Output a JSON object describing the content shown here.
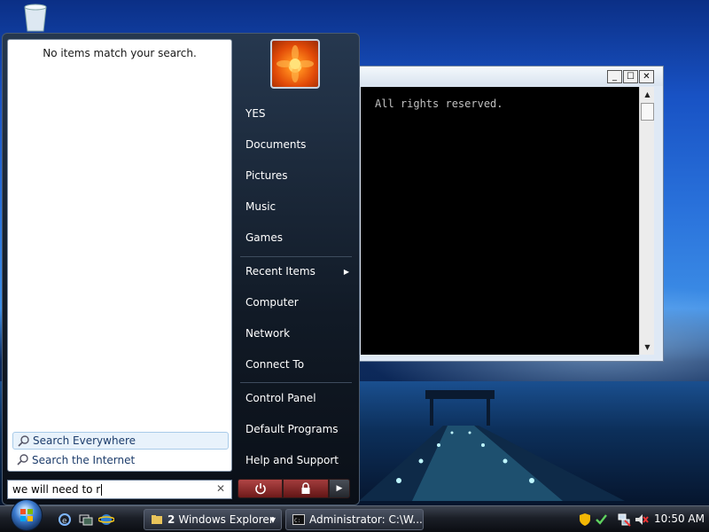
{
  "start_menu": {
    "left_pane": {
      "no_items_text": "No items match your search.",
      "search_options": [
        "Search Everywhere",
        "Search the Internet"
      ]
    },
    "search_box": {
      "value": "we will need to r"
    },
    "right_pane": {
      "group1": [
        "YES",
        "Documents",
        "Pictures",
        "Music",
        "Games"
      ],
      "group2": [
        "Recent Items",
        "Computer",
        "Network",
        "Connect To"
      ],
      "group3": [
        "Control Panel",
        "Default Programs",
        "Help and Support"
      ]
    },
    "power_buttons": [
      "power-icon",
      "lock-icon",
      "arrow-icon"
    ]
  },
  "console": {
    "text": "All rights reserved.",
    "buttons": [
      "_",
      "☐",
      "✕"
    ]
  },
  "taskbar": {
    "explorer": {
      "count": "2",
      "label": "Windows Explorer"
    },
    "cmd": {
      "label": "Administrator: C:\\W..."
    },
    "clock": "10:50 AM"
  }
}
